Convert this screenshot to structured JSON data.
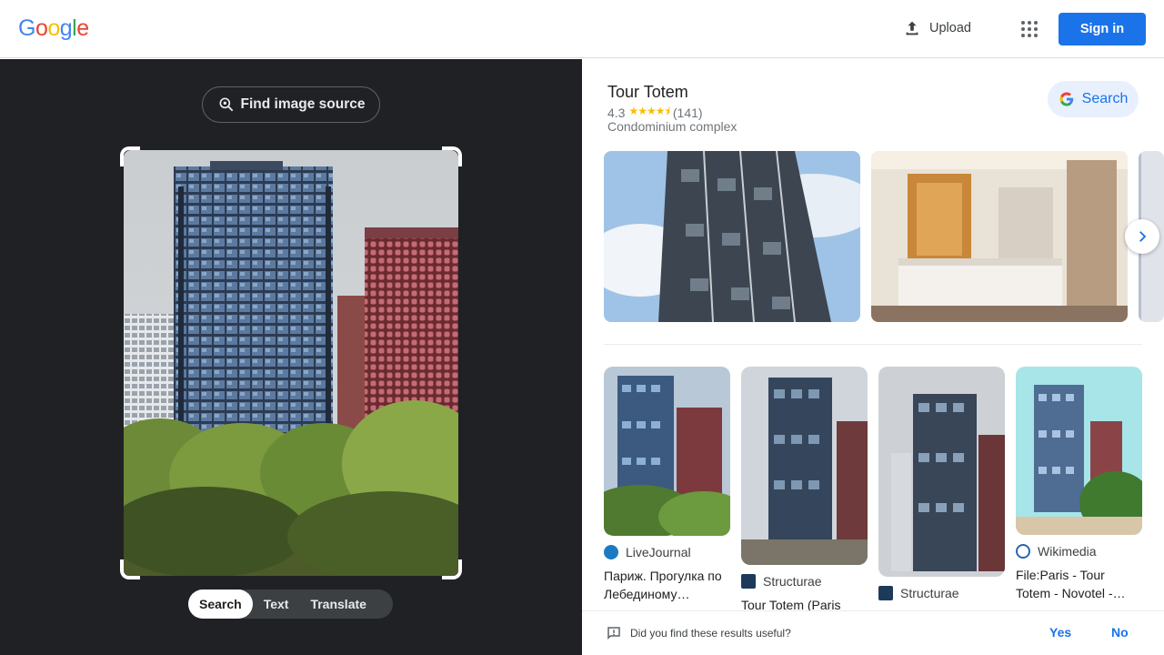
{
  "header": {
    "logo_letters": [
      "G",
      "o",
      "o",
      "g",
      "l",
      "e"
    ],
    "upload_label": "Upload",
    "signin_label": "Sign in"
  },
  "lens": {
    "find_source_label": "Find image source",
    "tabs": [
      {
        "label": "Search",
        "active": true
      },
      {
        "label": "Text",
        "active": false
      },
      {
        "label": "Translate",
        "active": false
      }
    ]
  },
  "knowledge_panel": {
    "title": "Tour Totem",
    "rating": "4.3",
    "stars": "★★★★⯨",
    "review_count": "(141)",
    "type": "Condominium complex",
    "search_label": "Search"
  },
  "results": [
    {
      "source": "LiveJournal",
      "title": "Париж. Прогулка по Лебединому…"
    },
    {
      "source": "Structurae",
      "title": "Tour Totem (Paris"
    },
    {
      "source": "Structurae",
      "title": ""
    },
    {
      "source": "Wikimedia",
      "title": "File:Paris - Tour Totem - Novotel -…"
    }
  ],
  "feedback": {
    "question": "Did you find these results useful?",
    "yes": "Yes",
    "no": "No"
  },
  "colors": {
    "accent": "#1a73e8",
    "dark_panel": "#202124",
    "google_blue": "#4285f4",
    "google_red": "#ea4335",
    "google_yellow": "#fbbc05",
    "google_green": "#34a853"
  }
}
